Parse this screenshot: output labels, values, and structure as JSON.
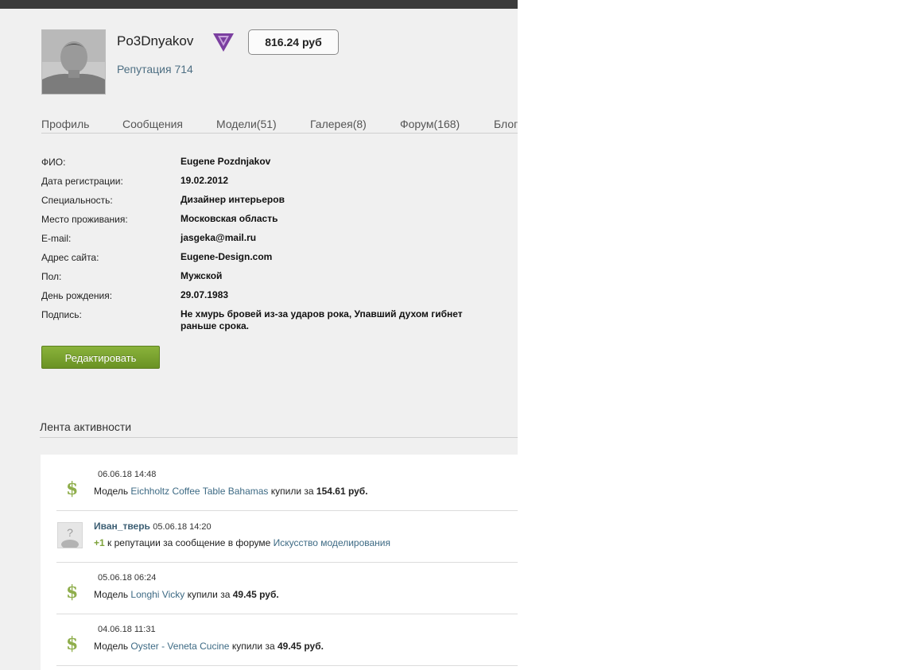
{
  "profile": {
    "username": "Po3Dnyakov",
    "balance": "816.24 руб",
    "reputation": "Репутация 714",
    "badge_icon": "violet-v-badge-icon"
  },
  "tabs": [
    {
      "label": "Профиль"
    },
    {
      "label": "Сообщения"
    },
    {
      "label": "Модели(51)"
    },
    {
      "label": "Галерея(8)"
    },
    {
      "label": "Форум(168)"
    },
    {
      "label": "Блоги"
    }
  ],
  "info": [
    {
      "label": "ФИО:",
      "value": "Eugene Pozdnjakov"
    },
    {
      "label": "Дата регистрации:",
      "value": "19.02.2012"
    },
    {
      "label": "Специальность:",
      "value": "Дизайнер интерьеров"
    },
    {
      "label": "Место проживания:",
      "value": "Московская область"
    },
    {
      "label": "E-mail:",
      "value": "jasgeka@mail.ru"
    },
    {
      "label": "Адрес сайта:",
      "value": "Eugene-Design.com"
    },
    {
      "label": "Пол:",
      "value": "Мужской"
    },
    {
      "label": "День рождения:",
      "value": "29.07.1983"
    },
    {
      "label": "Подпись:",
      "value": "Не хмурь бровей из-за ударов рока, Упавший духом гибнет раньше срока."
    }
  ],
  "edit_button": "Редактировать",
  "feed": {
    "title": "Лента активности",
    "items": [
      {
        "type": "purchase",
        "time": "06.06.18 14:48",
        "prefix": "Модель",
        "model": "Eichholtz Coffee Table Bahamas",
        "mid": "купили за",
        "price": "154.61 руб."
      },
      {
        "type": "reputation",
        "user": "Иван_тверь",
        "time": "05.06.18 14:20",
        "plus": "+1",
        "text": "к репутации за сообщение в форуме",
        "topic": "Искусство моделирования"
      },
      {
        "type": "purchase",
        "time": "05.06.18 06:24",
        "prefix": "Модель",
        "model": "Longhi Vicky",
        "mid": "купили за",
        "price": "49.45 руб."
      },
      {
        "type": "purchase",
        "time": "04.06.18 11:31",
        "prefix": "Модель",
        "model": "Oyster - Veneta Cucine",
        "mid": "купили за",
        "price": "49.45 руб."
      }
    ]
  },
  "colors": {
    "accent_green": "#7aa12e",
    "link": "#3d6a84",
    "dollar": "#8fae4c",
    "badge": "#7b3fa0"
  }
}
